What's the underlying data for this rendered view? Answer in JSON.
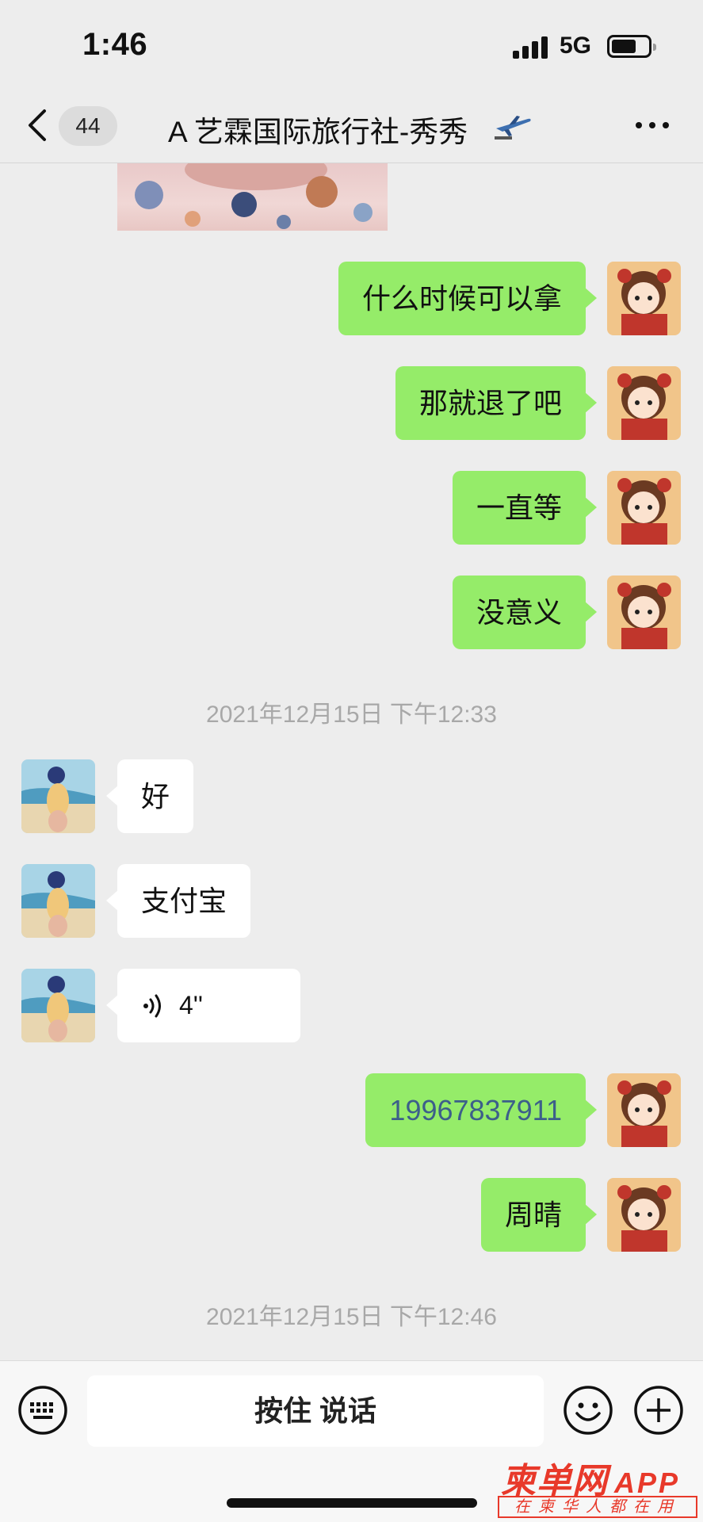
{
  "status_bar": {
    "time": "1:46",
    "network": "5G"
  },
  "header": {
    "unread_count": "44",
    "title": "A 艺霖国际旅行社-秀秀",
    "title_icon": "airplane-icon"
  },
  "messages": [
    {
      "sender": "me",
      "text": "什么时候可以拿"
    },
    {
      "sender": "me",
      "text": "那就退了吧"
    },
    {
      "sender": "me",
      "text": "一直等"
    },
    {
      "sender": "me",
      "text": "没意义"
    },
    {
      "sender": "other",
      "text": "好"
    },
    {
      "sender": "other",
      "text": "支付宝"
    },
    {
      "sender": "other",
      "type": "voice",
      "duration": "4''"
    },
    {
      "sender": "me",
      "text": "19967837911"
    },
    {
      "sender": "me",
      "text": "周晴"
    }
  ],
  "timestamps": [
    "2021年12月15日 下午12:33",
    "2021年12月15日 下午12:46"
  ],
  "input_bar": {
    "hold_to_talk": "按住 说话"
  },
  "watermark": {
    "main": "柬单网",
    "app": "APP",
    "slogan": "在柬华人都在用"
  },
  "colors": {
    "my_bubble": "#95ec69",
    "other_bubble": "#ffffff",
    "background": "#ededed",
    "watermark": "#e8392a"
  }
}
